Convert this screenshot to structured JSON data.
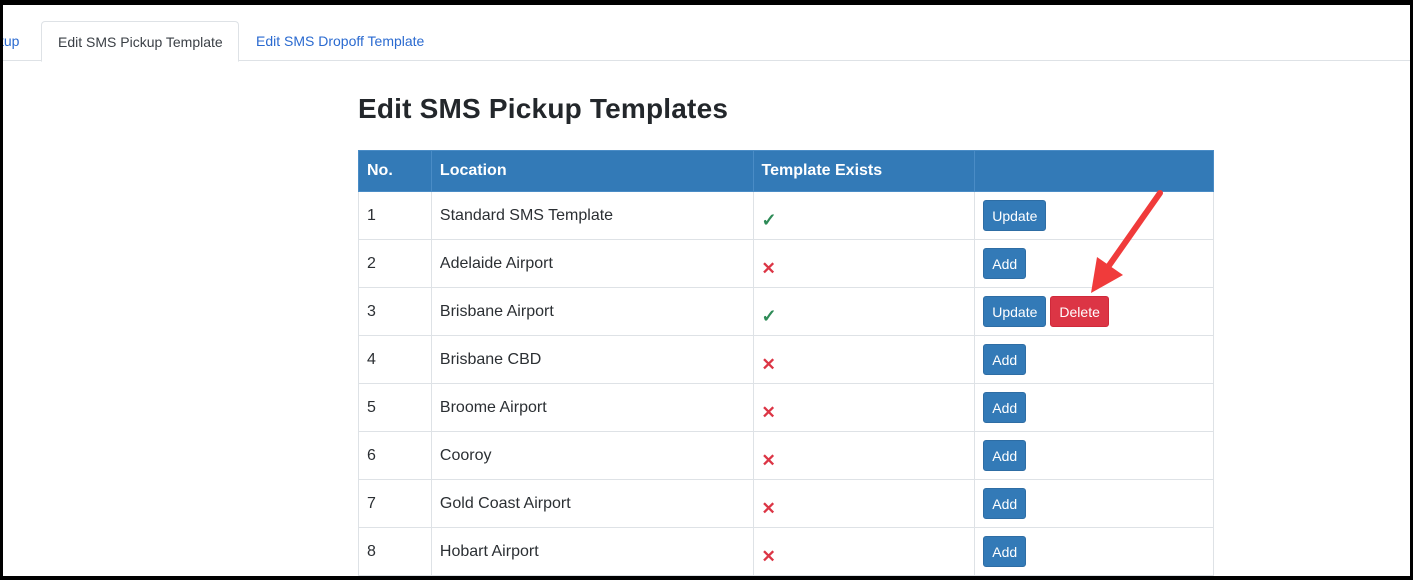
{
  "tabs": {
    "partial_label": "tup",
    "pickup_label": "Edit SMS Pickup Template",
    "dropoff_label": "Edit SMS Dropoff Template"
  },
  "page": {
    "title": "Edit SMS Pickup Templates"
  },
  "table": {
    "headers": {
      "no": "No.",
      "location": "Location",
      "exists": "Template Exists",
      "actions": ""
    },
    "rows": [
      {
        "no": "1",
        "location": "Standard SMS Template",
        "exists": "✓",
        "update": "Update"
      },
      {
        "no": "2",
        "location": "Adelaide Airport",
        "exists": "✕",
        "add": "Add"
      },
      {
        "no": "3",
        "location": "Brisbane Airport",
        "exists": "✓",
        "update": "Update",
        "delete": "Delete"
      },
      {
        "no": "4",
        "location": "Brisbane CBD",
        "exists": "✕",
        "add": "Add"
      },
      {
        "no": "5",
        "location": "Broome Airport",
        "exists": "✕",
        "add": "Add"
      },
      {
        "no": "6",
        "location": "Cooroy",
        "exists": "✕",
        "add": "Add"
      },
      {
        "no": "7",
        "location": "Gold Coast Airport",
        "exists": "✕",
        "add": "Add"
      },
      {
        "no": "8",
        "location": "Hobart Airport",
        "exists": "✕",
        "add": "Add"
      }
    ]
  },
  "icons": {
    "tick": "check-icon",
    "cross": "cross-icon",
    "annotation": "arrow-annotation"
  },
  "colors": {
    "header_blue": "#337ab7",
    "delete_red": "#dc3545",
    "tick_green": "#2e8b57",
    "arrow_red": "#f03b3b",
    "tab_link": "#2a6ad0"
  }
}
